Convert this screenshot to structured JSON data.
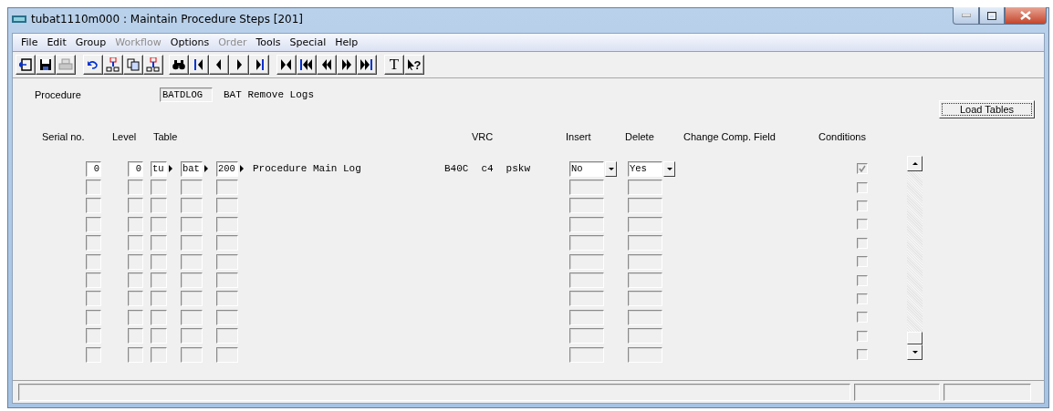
{
  "window": {
    "title": "tubat1110m000 : Maintain Procedure Steps [201]"
  },
  "menu": [
    {
      "label": "File",
      "disabled": false
    },
    {
      "label": "Edit",
      "disabled": false
    },
    {
      "label": "Group",
      "disabled": false
    },
    {
      "label": "Workflow",
      "disabled": true
    },
    {
      "label": "Options",
      "disabled": false
    },
    {
      "label": "Order",
      "disabled": true
    },
    {
      "label": "Tools",
      "disabled": false
    },
    {
      "label": "Special",
      "disabled": false
    },
    {
      "label": "Help",
      "disabled": false
    }
  ],
  "toolbar": {
    "text_tool": "T",
    "help_tool": "?"
  },
  "procedure": {
    "label": "Procedure",
    "code": "BATDLOG",
    "description": "BAT Remove Logs"
  },
  "load_tables_button": "Load Tables",
  "columns": [
    "Serial no.",
    "Level",
    "Table",
    "VRC",
    "Insert",
    "Delete",
    "Change Comp. Field",
    "Conditions"
  ],
  "rows": [
    {
      "kind": "entry",
      "serial": "0",
      "level": "0",
      "table": [
        "tu",
        "bat",
        "200"
      ],
      "description": "Procedure Main Log",
      "vrc": [
        "B40C",
        "c4",
        "pskw"
      ],
      "insert": "No",
      "delete": "Yes",
      "conditions": true
    },
    {
      "kind": "empty",
      "conditions": false
    },
    {
      "kind": "empty",
      "conditions": false
    },
    {
      "kind": "empty",
      "conditions": false
    },
    {
      "kind": "empty",
      "conditions": false
    },
    {
      "kind": "empty",
      "conditions": false
    },
    {
      "kind": "empty",
      "conditions": false
    },
    {
      "kind": "empty",
      "conditions": false
    },
    {
      "kind": "empty",
      "conditions": false
    },
    {
      "kind": "empty",
      "conditions": false
    },
    {
      "kind": "empty",
      "conditions": false
    }
  ]
}
